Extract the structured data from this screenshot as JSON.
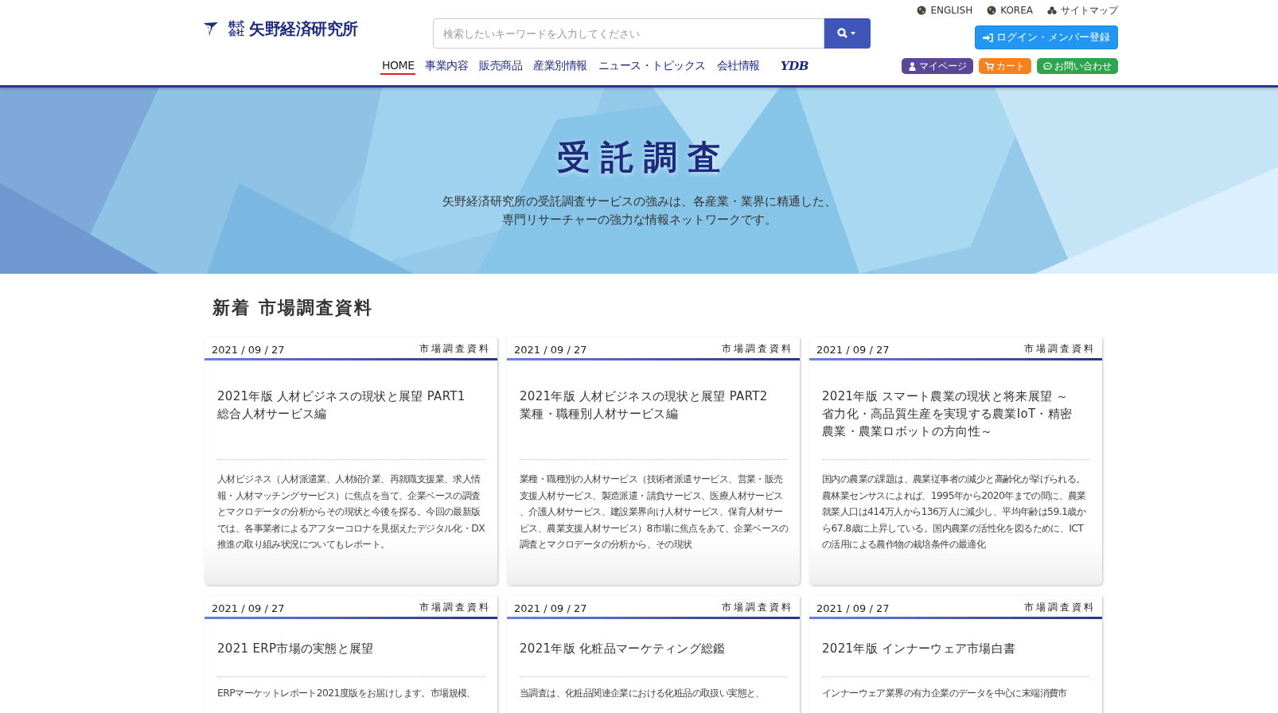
{
  "header": {
    "logo": {
      "prefix": "株式会社",
      "name": "矢野経済研究所"
    },
    "top_links": [
      {
        "label": "ENGLISH",
        "kind": "globe"
      },
      {
        "label": "KOREA",
        "kind": "globe"
      },
      {
        "label": "サイトマップ",
        "kind": "sitemap"
      }
    ],
    "search": {
      "placeholder": "検索したいキーワードを入力してください"
    },
    "login_button": "ログイン・メンバー登録",
    "nav": [
      {
        "label": "HOME",
        "selected": true,
        "kind": "text"
      },
      {
        "label": "事業内容",
        "selected": false,
        "kind": "text"
      },
      {
        "label": "販売商品",
        "selected": false,
        "kind": "text"
      },
      {
        "label": "産業別情報",
        "selected": false,
        "kind": "text"
      },
      {
        "label": "ニュース・トピックス",
        "selected": false,
        "kind": "text"
      },
      {
        "label": "会社情報",
        "selected": false,
        "kind": "text"
      },
      {
        "label": "YDB",
        "selected": false,
        "kind": "logo"
      }
    ],
    "member_buttons": [
      {
        "label": "マイページ",
        "kind": "mypage"
      },
      {
        "label": "カート",
        "kind": "cart"
      },
      {
        "label": "お問い合わせ",
        "kind": "contact"
      }
    ]
  },
  "hero": {
    "title": "受託調査",
    "lines": [
      "矢野経済研究所の受託調査サービスの強みは、各産業・業界に精通した、",
      "専門リサーチャーの強力な情報ネットワークです。"
    ]
  },
  "section_title": "新着 市場調査資料",
  "cards": [
    {
      "date": "2021 / 09 / 27",
      "category": "市場調査資料",
      "title": [
        "2021年版 人材ビジネスの現状と展望 PART1",
        "総合人材サービス編"
      ],
      "description": "人材ビジネス（人材派遣業、人材紹介業、再就職支援業、求人情報・人材マッチングサービス）に焦点を当て、企業ベースの調査とマクロデータの分析からその現状と今後を探る。今回の最新版では、各事業者によるアフターコロナを見据えたデジタル化・DX推進の取り組み状況についてもレポート。"
    },
    {
      "date": "2021 / 09 / 27",
      "category": "市場調査資料",
      "title": [
        "2021年版 人材ビジネスの現状と展望 PART2",
        "業種・職種別人材サービス編"
      ],
      "description": "業種・職種別の人材サービス（技術者派遣サービス、営業・販売支援人材サービス、製造派遣・請負サービス、医療人材サービス、介護人材サービス、建設業界向け人材サービス、保育人材サービス、農業支援人材サービス）8市場に焦点をあて、企業ベースの調査とマクロデータの分析から、その現状"
    },
    {
      "date": "2021 / 09 / 27",
      "category": "市場調査資料",
      "title": [
        "2021年版 スマート農業の現状と将来展望 ～",
        "省力化・高品質生産を実現する農業IoT・精密",
        "農業・農業ロボットの方向性～"
      ],
      "description": "国内の農業の課題は、農業従事者の減少と高齢化が挙げられる。農林業センサスによれば、1995年から2020年までの間に、農業就業人口は414万人から136万人に減少し、平均年齢は59.1歳から67.8歳に上昇している。国内農業の活性化を図るために、ICTの活用による農作物の栽培条件の最適化"
    },
    {
      "date": "2021 / 09 / 27",
      "category": "市場調査資料",
      "title": [
        "2021 ERP市場の実態と展望"
      ],
      "description": "ERPマーケットレポート2021度版をお届けします。市場規模、"
    },
    {
      "date": "2021 / 09 / 27",
      "category": "市場調査資料",
      "title": [
        "2021年版 化粧品マーケティング総鑑"
      ],
      "description": "当調査は、化粧品関連企業における化粧品の取扱い実態と、"
    },
    {
      "date": "2021 / 09 / 27",
      "category": "市場調査資料",
      "title": [
        "2021年版 インナーウェア市場白書"
      ],
      "description": "インナーウェア業界の有力企業のデータを中心に末端消費市"
    }
  ]
}
